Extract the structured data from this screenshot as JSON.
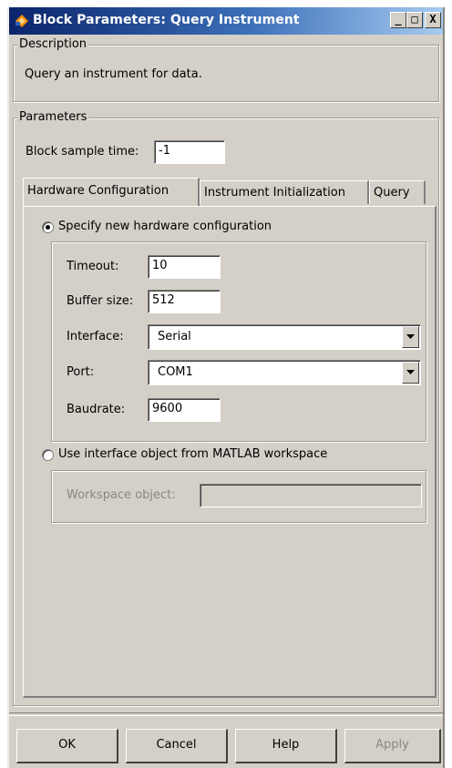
{
  "window": {
    "title": "Block Parameters: Query Instrument"
  },
  "title_buttons": {
    "minimize": "_",
    "maximize": "□",
    "close": "X"
  },
  "description": {
    "legend": "Description",
    "text": "Query an instrument for data."
  },
  "parameters": {
    "legend": "Parameters",
    "sample_time_label": "Block sample time:",
    "sample_time_value": "-1"
  },
  "tabs": [
    {
      "label": "Hardware Configuration",
      "active": true
    },
    {
      "label": "Instrument Initialization",
      "active": false
    },
    {
      "label": "Query",
      "active": false
    }
  ],
  "hardware": {
    "option_new_label": "Specify new hardware configuration",
    "option_new_selected": true,
    "timeout_label": "Timeout:",
    "timeout_value": "10",
    "buffer_label": "Buffer size:",
    "buffer_value": "512",
    "interface_label": "Interface:",
    "interface_value": "Serial",
    "port_label": "Port:",
    "port_value": "COM1",
    "baudrate_label": "Baudrate:",
    "baudrate_value": "9600",
    "option_workspace_label": "Use interface object from MATLAB workspace",
    "option_workspace_selected": false,
    "workspace_object_label": "Workspace object:",
    "workspace_object_value": ""
  },
  "buttons": {
    "ok": "OK",
    "cancel": "Cancel",
    "help": "Help",
    "apply": "Apply"
  },
  "colors": {
    "dialog_bg": "#d4d0c8",
    "title_start": "#0a246a",
    "title_end": "#a6caf0",
    "disabled_text": "#8a8780"
  },
  "icons": [
    "simulink-block-icon",
    "minimize-icon",
    "maximize-icon",
    "close-icon",
    "dropdown-arrow-icon",
    "radio-icon"
  ]
}
